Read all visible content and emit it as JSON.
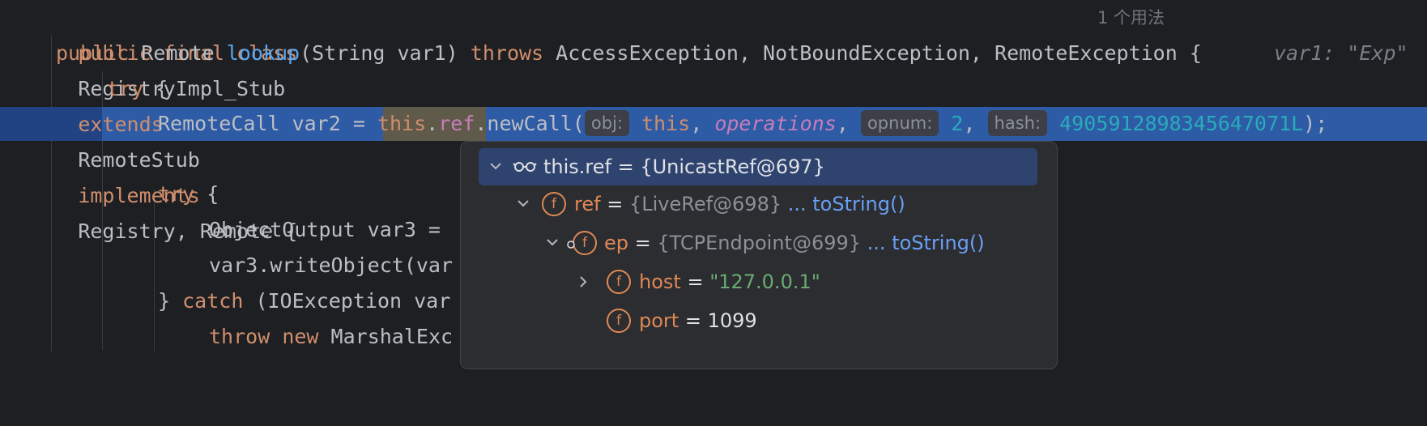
{
  "code": {
    "line1": {
      "kw1": "public final class",
      "name": "RegistryImpl_Stub",
      "kw2": "extends",
      "base": "RemoteStub",
      "kw3": "implements",
      "ifaces": "Registry, Remote {",
      "hint": "1 个用法"
    },
    "line2": {
      "kw": "public",
      "type": "Remote",
      "method": "lookup",
      "params": "(String var1)",
      "throws": "throws",
      "exceptions": "AccessException, NotBoundException, RemoteException {",
      "inlay": "var1: \"Exp\""
    },
    "line3": {
      "kw": "try",
      "brace": "{"
    },
    "line4": {
      "prefix": "RemoteCall var2 = ",
      "this_kw": "this",
      "dot": ".",
      "ref": "ref",
      "call": ".newCall(",
      "p_obj": "obj:",
      "this2": "this",
      "comma1": ", ",
      "ops": "operations",
      "comma2": ", ",
      "p_opnum": "opnum:",
      "opnum": "2",
      "comma3": ", ",
      "p_hash": "hash:",
      "hash": "4905912898345647071L",
      "end": ");"
    },
    "line6": {
      "kw": "try",
      "brace": "{"
    },
    "line7": {
      "text": "ObjectOutput var3 ="
    },
    "line8": {
      "text": "var3.writeObject(var"
    },
    "line9": {
      "pre": "} ",
      "kw": "catch",
      "rest": "(IOException var"
    },
    "line10": {
      "kw1": "throw",
      "kw2": "new",
      "rest": "MarshalExc"
    }
  },
  "popup": {
    "root": {
      "expr": "this.ref = {UnicastRef@697}"
    },
    "rows": [
      {
        "name": "ref",
        "eq": " = ",
        "value": "{LiveRef@698}",
        "link": "... toString()"
      },
      {
        "name": "ep",
        "eq": " = ",
        "value": "{TCPEndpoint@699}",
        "link": "... toString()"
      },
      {
        "name": "host",
        "eq": " = ",
        "value": "\"127.0.0.1\""
      },
      {
        "name": "port",
        "eq": " = ",
        "value": "1099"
      }
    ],
    "field_icon": "f"
  },
  "icons": {
    "expand": "chevron-down-icon",
    "collapsed": "chevron-right-icon",
    "watch": "glasses-icon",
    "field": "field-icon"
  },
  "colors": {
    "background": "#1e1f22",
    "keyword": "#cf8e6d",
    "method": "#56a8f5",
    "field": "#c77dbb",
    "number": "#2aacb8",
    "execution_line": "#214283",
    "popup_bg": "#2b2d30"
  }
}
